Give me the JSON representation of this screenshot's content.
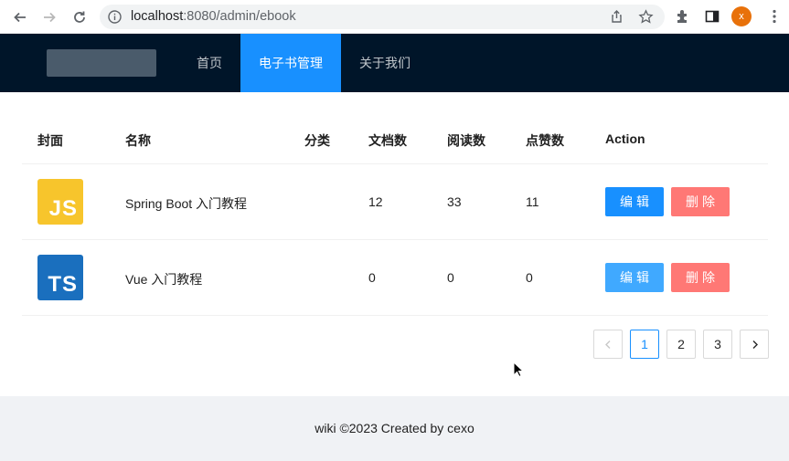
{
  "browser": {
    "url_host": "localhost",
    "url_path": ":8080/admin/ebook",
    "avatar_initial": "x",
    "icons": [
      "back-icon",
      "forward-icon",
      "reload-icon",
      "info-icon",
      "share-icon",
      "star-icon",
      "extensions-icon",
      "sidebar-icon",
      "kebab-menu-icon"
    ]
  },
  "header": {
    "menu": [
      {
        "label": "首页",
        "active": false
      },
      {
        "label": "电子书管理",
        "active": true
      },
      {
        "label": "关于我们",
        "active": false
      }
    ]
  },
  "table": {
    "columns": [
      "封面",
      "名称",
      "分类",
      "文档数",
      "阅读数",
      "点赞数",
      "Action"
    ],
    "rows": [
      {
        "cover_text": "JS",
        "cover_color": "#f7c52c",
        "name": "Spring Boot 入门教程",
        "category": "",
        "doc_count": "12",
        "view_count": "33",
        "vote_count": "11",
        "edit_label": "编辑",
        "delete_label": "删除"
      },
      {
        "cover_text": "TS",
        "cover_color": "#1a6fbe",
        "name": "Vue 入门教程",
        "category": "",
        "doc_count": "0",
        "view_count": "0",
        "vote_count": "0",
        "edit_label": "编辑",
        "delete_label": "删除"
      }
    ]
  },
  "pagination": {
    "pages": [
      "1",
      "2",
      "3"
    ],
    "current": "1"
  },
  "footer": {
    "text": "wiki ©2023 Created by cexo"
  },
  "colors": {
    "header_bg": "#001529",
    "accent": "#1890ff",
    "danger": "#ff7875",
    "footer_bg": "#f0f2f5"
  }
}
